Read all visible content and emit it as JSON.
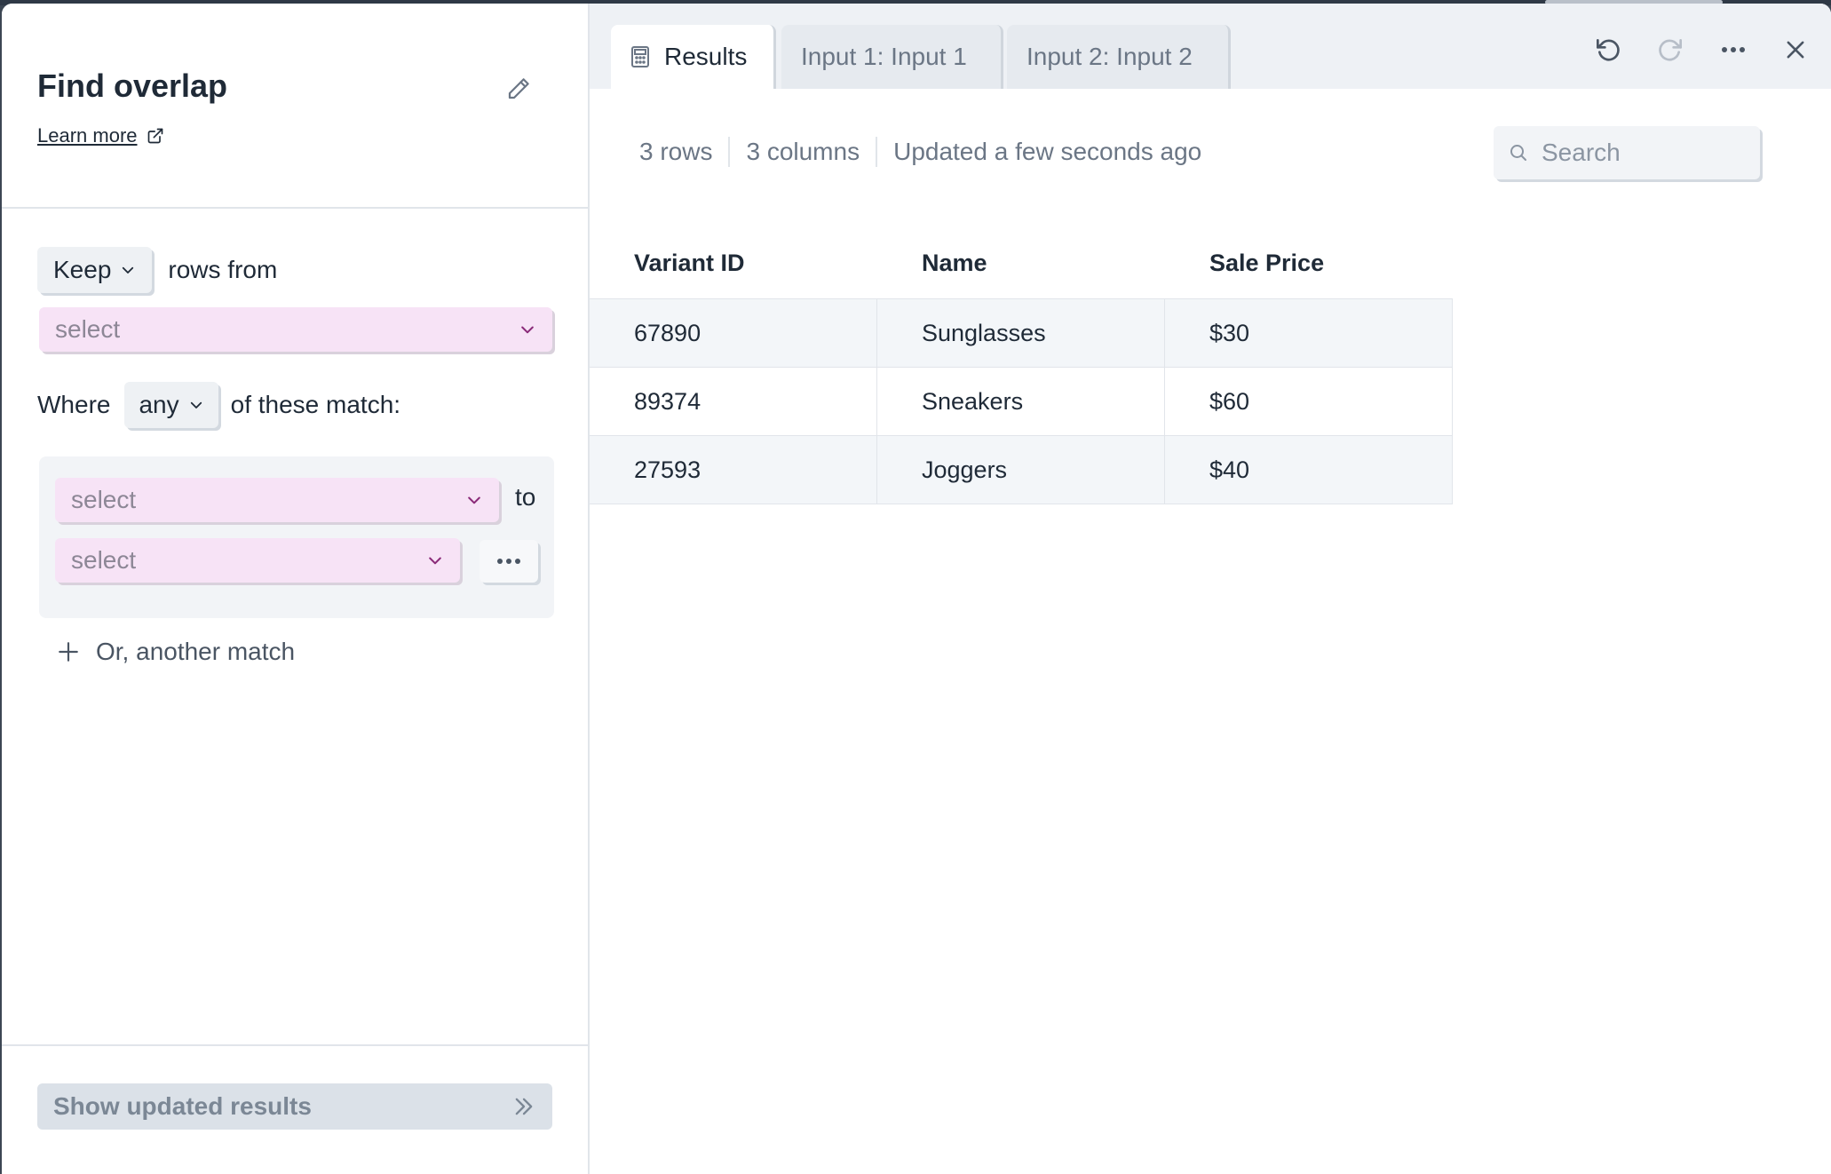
{
  "panel": {
    "title": "Find overlap",
    "learn_more": "Learn more",
    "keep_label": "Keep",
    "rows_from": "rows from",
    "source_select": "select",
    "where": "Where",
    "any_label": "any",
    "of_these_match": "of these match:",
    "match_select_1": "select",
    "to": "to",
    "match_select_2": "select",
    "add_match": "Or, another match",
    "show_updated": "Show updated results"
  },
  "tabs": [
    {
      "label": "Results"
    },
    {
      "label": "Input 1: Input 1"
    },
    {
      "label": "Input 2: Input 2"
    }
  ],
  "meta": {
    "rows": "3 rows",
    "columns": "3 columns",
    "updated": "Updated a few seconds ago"
  },
  "search": {
    "placeholder": "Search"
  },
  "table": {
    "headers": [
      "Variant ID",
      "Name",
      "Sale Price"
    ],
    "rows": [
      [
        "67890",
        "Sunglasses",
        "$30"
      ],
      [
        "89374",
        "Sneakers",
        "$60"
      ],
      [
        "27593",
        "Joggers",
        "$40"
      ]
    ]
  },
  "colors": {
    "pink_select": "#f7e3f6",
    "select_chevron": "#8a2a78",
    "background": "#3c4653"
  }
}
